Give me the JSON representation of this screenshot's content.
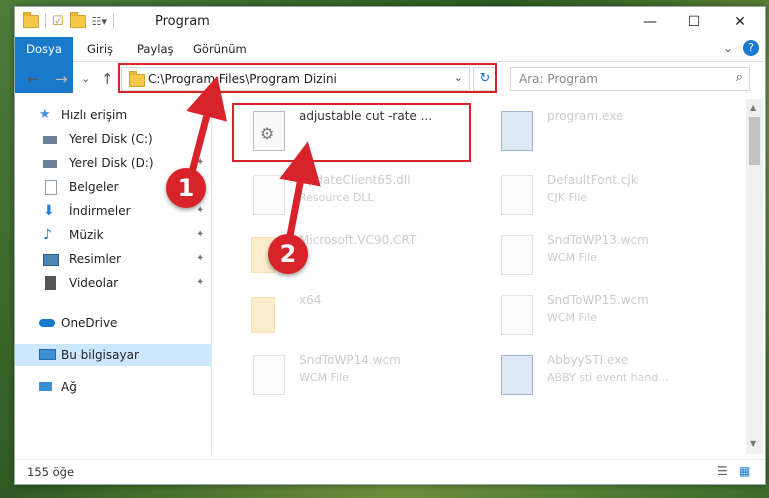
{
  "window": {
    "title": "Program",
    "minimize": "—",
    "maximize": "☐",
    "close": "✕"
  },
  "ribbon": {
    "tabs": [
      "Dosya",
      "Giriş",
      "Paylaş",
      "Görünüm"
    ],
    "expand": "⌄",
    "help": "?"
  },
  "address": {
    "path": "C:\\Program Files\\Program Dizini",
    "dropdown": "⌄",
    "refresh": "↻"
  },
  "search": {
    "placeholder": "Ara: Program",
    "icon": "⌕"
  },
  "nav_buttons": {
    "back": "←",
    "forward": "→",
    "recent": "⌄",
    "up": "↑"
  },
  "nav_pane": [
    {
      "label": "Hızlı erişim",
      "icon": "star-icon",
      "color": "#3a8ee6",
      "pinned": false
    },
    {
      "label": "Yerel Disk (C:)",
      "icon": "drive-icon",
      "color": "#6a7f93",
      "pinned": true
    },
    {
      "label": "Yerel Disk (D:)",
      "icon": "drive-icon",
      "color": "#6a7f93",
      "pinned": true
    },
    {
      "label": "Belgeler",
      "icon": "documents-icon",
      "color": "#8aa1b5",
      "pinned": true
    },
    {
      "label": "İndirmeler",
      "icon": "download-icon",
      "color": "#2b7cd3",
      "pinned": true
    },
    {
      "label": "Müzik",
      "icon": "music-icon",
      "color": "#2b7cd3",
      "pinned": true
    },
    {
      "label": "Resimler",
      "icon": "pictures-icon",
      "color": "#4b86b4",
      "pinned": true
    },
    {
      "label": "Videolar",
      "icon": "videos-icon",
      "color": "#555555",
      "pinned": true
    },
    {
      "label": "OneDrive",
      "icon": "cloud-icon",
      "color": "#1979ca",
      "pinned": false
    },
    {
      "label": "Bu bilgisayar",
      "icon": "computer-icon",
      "color": "#3b8fd6",
      "pinned": false
    },
    {
      "label": "Ağ",
      "icon": "network-icon",
      "color": "#3b8fd6",
      "pinned": false
    }
  ],
  "pin_glyph": "📌",
  "files": [
    {
      "name": "adjustable cut -rate ...",
      "type": "",
      "icon": "settings-file-icon"
    },
    {
      "name": "program.exe",
      "type": "",
      "icon": "exe-icon"
    },
    {
      "name": "UpdateClient65.dll",
      "type": "Resource DLL",
      "icon": "dll-icon"
    },
    {
      "name": "DefaultFont.cjk",
      "type": "CJK File",
      "icon": "file-icon"
    },
    {
      "name": "Microsoft.VC90.CRT",
      "type": "",
      "icon": "folder-icon"
    },
    {
      "name": "SndToWP13.wcm",
      "type": "WCM File",
      "icon": "file-icon"
    },
    {
      "name": "x64",
      "type": "",
      "icon": "folder-icon"
    },
    {
      "name": "SndToWP15.wcm",
      "type": "WCM File",
      "icon": "file-icon"
    },
    {
      "name": "SndToWP14.wcm",
      "type": "WCM File",
      "icon": "file-icon"
    },
    {
      "name": "AbbyySTI.exe",
      "type": "ABBY sti event hand...",
      "icon": "exe-icon"
    }
  ],
  "status": {
    "count": "155 öğe"
  },
  "annotations": {
    "step1": "1",
    "step2": "2",
    "color": "#d8232a"
  }
}
